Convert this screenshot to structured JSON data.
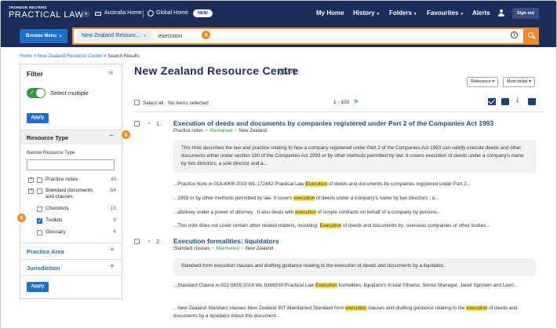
{
  "header": {
    "brand_small": "THOMSON REUTERS",
    "brand": "PRACTICAL LAW",
    "home_dropdown_icon": "chevron-down-icon",
    "australia_home": "Australia Home",
    "global_home": "Global Home",
    "new_badge": "NEW",
    "nav": [
      "My Home",
      "History",
      "Folders",
      "Favourites",
      "Alerts"
    ],
    "sign_out": "Sign out",
    "colors": {
      "navy": "#1c2d5a",
      "orange": "#f08a24",
      "blue": "#1e6fc6",
      "green": "#2e9a3e"
    }
  },
  "search": {
    "browse_menu": "Browse Menu",
    "scope": "New Zealand Resourc...",
    "query": "execution",
    "callout_search": "4"
  },
  "breadcrumb": {
    "home": "Home",
    "sep1": ">",
    "centre": "New Zealand Resource Centre",
    "sep2": ">",
    "current": "Search Results"
  },
  "filter": {
    "title": "Filter",
    "collapse_icon": "«",
    "select_multiple": "Select multiple",
    "apply": "Apply",
    "resource_type": "Resource Type",
    "minus": "−",
    "callout_resource": "5",
    "narrow_label": "Narrow Resource Type",
    "items": [
      {
        "label": "Practice notes",
        "count": "43"
      },
      {
        "label": "Standard documents and clauses",
        "count": "54"
      },
      {
        "label": "Checklists",
        "count": "15"
      },
      {
        "label": "Toolkits",
        "count": "9"
      },
      {
        "label": "Glossary",
        "count": "4"
      }
    ],
    "callout_toolkits": "6",
    "facets": [
      "Practice Area",
      "Jurisdiction"
    ],
    "plus": "+",
    "apply_bottom": "Apply"
  },
  "main": {
    "title": "New Zealand Resource Centre",
    "count": "(127)",
    "sort_relevance": "Relevance",
    "sort_detail": "Most detail",
    "select_all": "Select all",
    "no_items": "No items selected",
    "range": "1 - 100",
    "next": ">"
  },
  "results": [
    {
      "number": "1.",
      "title": "Execution of deeds and documents by companies registered under Part 2 of the Companies Act 1993",
      "type": "Practice notes",
      "status": "Maintained",
      "jurisdiction": "New Zealand",
      "summary": "This note describes the law and practice relating to how a company registered under Part 2 of the Companies Act 1993 can validly execute deeds and other documents either under section 180 of the Companies Act 1993 or by other methods permitted by law. It covers execution of deeds under a company's name by two directors, a sole director and a...",
      "snippets": [
        {
          "pre": "...Practice Note w-018-4908 2019 WL 172442 Practical Law ",
          "hl": "Execution",
          "post": " of deeds and documents by companies registered under Part 2..."
        },
        {
          "pre": "...1993 or by other methods permitted by law. It covers ",
          "hl": "execution",
          "post": " of deeds under a company's name by two directors , a..."
        },
        {
          "pre": "...attorney under a power of attorney . It also deals with ",
          "hl": "execution",
          "post": " of simple contracts on behalf of a company by persons..."
        },
        {
          "pre": "...This note does not cover certain other related matters, including: ",
          "hl": "Execution",
          "post": " of deeds and documents by: overseas companies or other bodies..."
        }
      ]
    },
    {
      "number": "2.",
      "title": "Execution formalities: liquidators",
      "type": "Standard clauses",
      "status": "Maintained",
      "jurisdiction": "New Zealand",
      "summary": "Standard form execution clauses and drafting guidance relating to the execution of deeds and documents by a liquidator.",
      "snippets": [
        {
          "pre": "...Standard Clause w-022-5655 2019 WL 5388030 Practical Law ",
          "hl": "Execution",
          "post": " formalities: liquidators Kristal Pihama, Senior Manager, Janet Sprosen and Leon..."
        },
        {
          "pre": "...New Zealand Standard clauses New Zealand INT Maintained Standard form ",
          "hl": "execution",
          "post": " clauses and drafting guidance relating to the ",
          "hl2": "execution",
          "post2": " of deeds and documents by a liquidator About this document..."
        }
      ]
    }
  ]
}
